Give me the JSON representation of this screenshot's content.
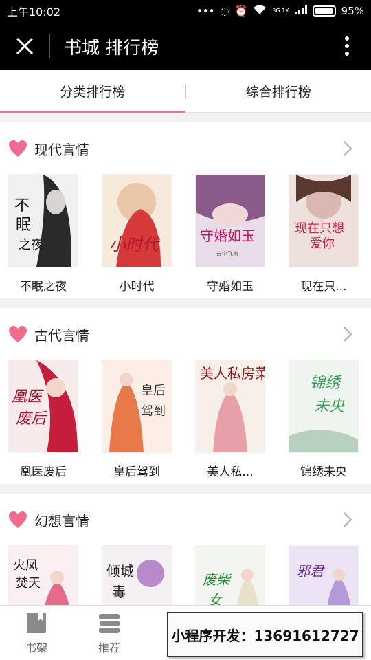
{
  "status": {
    "time": "上午10:02",
    "network_top": "3G",
    "network_bottom": "1X",
    "battery": "95%"
  },
  "header": {
    "title": "书城 排行榜"
  },
  "tabs": [
    {
      "label": "分类排行榜",
      "active": true
    },
    {
      "label": "综合排行榜",
      "active": false
    }
  ],
  "sections": [
    {
      "title": "现代言情",
      "books": [
        {
          "title": "不眠之夜",
          "cover_text": "不眠之夜"
        },
        {
          "title": "小时代",
          "cover_text": "小时代"
        },
        {
          "title": "守婚如玉",
          "cover_text": "守婚如玉"
        },
        {
          "title": "现在只...",
          "cover_text": "现在只想爱你"
        }
      ]
    },
    {
      "title": "古代言情",
      "books": [
        {
          "title": "凰医废后",
          "cover_text": "凰医废后"
        },
        {
          "title": "皇后驾到",
          "cover_text": "皇后驾到"
        },
        {
          "title": "美人私...",
          "cover_text": "美人私房菜"
        },
        {
          "title": "锦绣未央",
          "cover_text": "锦绣未央"
        }
      ]
    },
    {
      "title": "幻想言情",
      "books": [
        {
          "title": "",
          "cover_text": "火凤焚天"
        },
        {
          "title": "",
          "cover_text": "倾城毒"
        },
        {
          "title": "",
          "cover_text": "废柴女"
        },
        {
          "title": "",
          "cover_text": "邪君"
        }
      ]
    }
  ],
  "bottom_nav": [
    {
      "label": "书架",
      "icon": "book-icon"
    },
    {
      "label": "推荐",
      "icon": "stack-icon"
    }
  ],
  "promo": {
    "text": "小程序开发：13691612727"
  },
  "colors": {
    "accent": "#f06b8e",
    "header_bg": "#000000"
  }
}
